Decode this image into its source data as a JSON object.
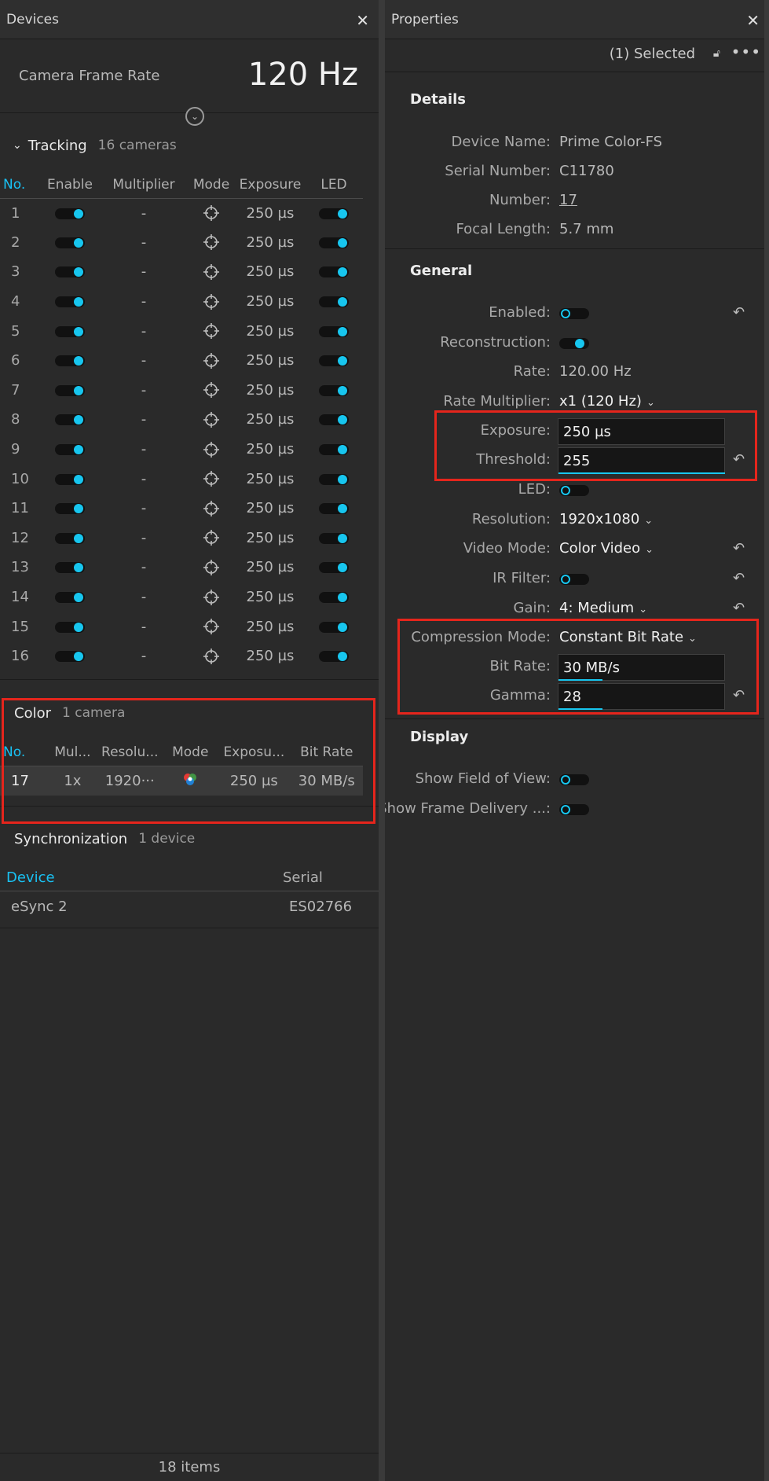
{
  "devices_panel": {
    "title": "Devices",
    "frame_rate_label": "Camera Frame Rate",
    "frame_rate_value": "120 Hz",
    "tracking": {
      "name": "Tracking",
      "count": "16 cameras",
      "columns": [
        "No.",
        "Enable",
        "Multiplier",
        "Mode",
        "Exposure",
        "LED"
      ],
      "rows": [
        {
          "no": "1",
          "multiplier": "-",
          "exposure": "250 µs"
        },
        {
          "no": "2",
          "multiplier": "-",
          "exposure": "250 µs"
        },
        {
          "no": "3",
          "multiplier": "-",
          "exposure": "250 µs"
        },
        {
          "no": "4",
          "multiplier": "-",
          "exposure": "250 µs"
        },
        {
          "no": "5",
          "multiplier": "-",
          "exposure": "250 µs"
        },
        {
          "no": "6",
          "multiplier": "-",
          "exposure": "250 µs"
        },
        {
          "no": "7",
          "multiplier": "-",
          "exposure": "250 µs"
        },
        {
          "no": "8",
          "multiplier": "-",
          "exposure": "250 µs"
        },
        {
          "no": "9",
          "multiplier": "-",
          "exposure": "250 µs"
        },
        {
          "no": "10",
          "multiplier": "-",
          "exposure": "250 µs"
        },
        {
          "no": "11",
          "multiplier": "-",
          "exposure": "250 µs"
        },
        {
          "no": "12",
          "multiplier": "-",
          "exposure": "250 µs"
        },
        {
          "no": "13",
          "multiplier": "-",
          "exposure": "250 µs"
        },
        {
          "no": "14",
          "multiplier": "-",
          "exposure": "250 µs"
        },
        {
          "no": "15",
          "multiplier": "-",
          "exposure": "250 µs"
        },
        {
          "no": "16",
          "multiplier": "-",
          "exposure": "250 µs"
        }
      ]
    },
    "color": {
      "name": "Color",
      "count": "1 camera",
      "columns": [
        "No.",
        "Mul...",
        "Resolu...",
        "Mode",
        "Exposu...",
        "Bit Rate"
      ],
      "row": {
        "no": "17",
        "multiplier": "1x",
        "resolution": "1920···",
        "exposure": "250 µs",
        "bit_rate": "30 MB/s"
      }
    },
    "sync": {
      "name": "Synchronization",
      "count": "1 device",
      "columns": [
        "Device",
        "Serial"
      ],
      "row": {
        "device": "eSync 2",
        "serial": "ES02766"
      }
    },
    "footer": "18 items"
  },
  "properties_panel": {
    "title": "Properties",
    "selected": "(1) Selected",
    "details": {
      "heading": "Details",
      "device_name_label": "Device Name:",
      "device_name": "Prime Color-FS",
      "serial_label": "Serial Number:",
      "serial": "C11780",
      "number_label": "Number:",
      "number": "17",
      "focal_label": "Focal Length:",
      "focal": "5.7 mm"
    },
    "general": {
      "heading": "General",
      "enabled_label": "Enabled:",
      "reconstruction_label": "Reconstruction:",
      "rate_label": "Rate:",
      "rate": "120.00 Hz",
      "multiplier_label": "Rate Multiplier:",
      "multiplier": "x1 (120 Hz)",
      "exposure_label": "Exposure:",
      "exposure": "250 µs",
      "threshold_label": "Threshold:",
      "threshold": "255",
      "led_label": "LED:",
      "resolution_label": "Resolution:",
      "resolution": "1920x1080",
      "video_mode_label": "Video Mode:",
      "video_mode": "Color Video",
      "ir_filter_label": "IR Filter:",
      "gain_label": "Gain:",
      "gain": "4: Medium",
      "compression_label": "Compression Mode:",
      "compression": "Constant Bit Rate",
      "bit_rate_label": "Bit Rate:",
      "bit_rate": "30 MB/s",
      "gamma_label": "Gamma:",
      "gamma": "28"
    },
    "display": {
      "heading": "Display",
      "fov_label": "Show Field of View:",
      "frame_delivery_label": "Show Frame Delivery ...:"
    }
  },
  "colors": {
    "accent": "#17c6ef",
    "highlight_box": "#e5251c"
  }
}
